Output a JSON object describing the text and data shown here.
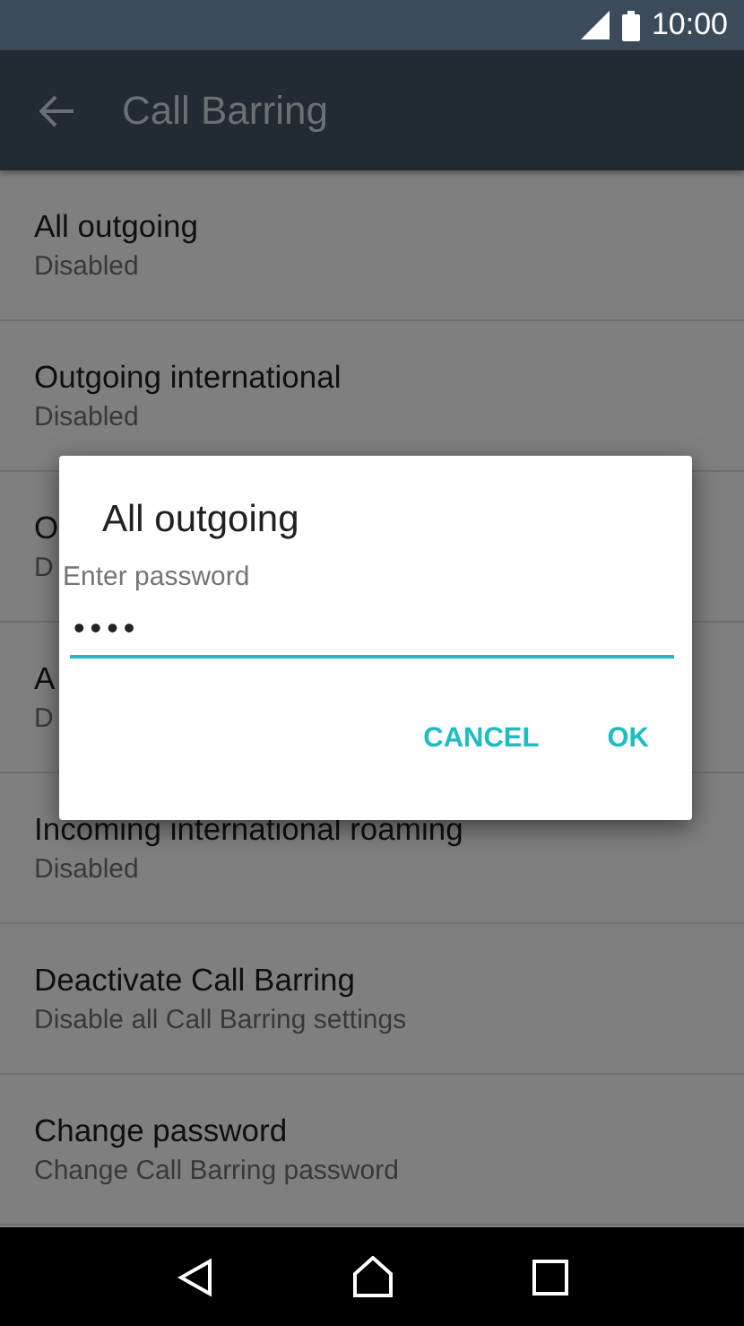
{
  "status_bar": {
    "time": "10:00"
  },
  "app_bar": {
    "title": "Call Barring"
  },
  "settings": [
    {
      "title": "All outgoing",
      "summary": "Disabled"
    },
    {
      "title": "Outgoing international",
      "summary": "Disabled"
    },
    {
      "title": "O",
      "summary": "D"
    },
    {
      "title": "A",
      "summary": "D"
    },
    {
      "title": "Incoming international roaming",
      "summary": "Disabled"
    },
    {
      "title": "Deactivate Call Barring",
      "summary": "Disable all Call Barring settings"
    },
    {
      "title": "Change password",
      "summary": "Change Call Barring password"
    }
  ],
  "dialog": {
    "title": "All outgoing",
    "field": {
      "label": "Enter password",
      "value": "••••"
    },
    "buttons": [
      "CANCEL",
      "OK"
    ]
  }
}
